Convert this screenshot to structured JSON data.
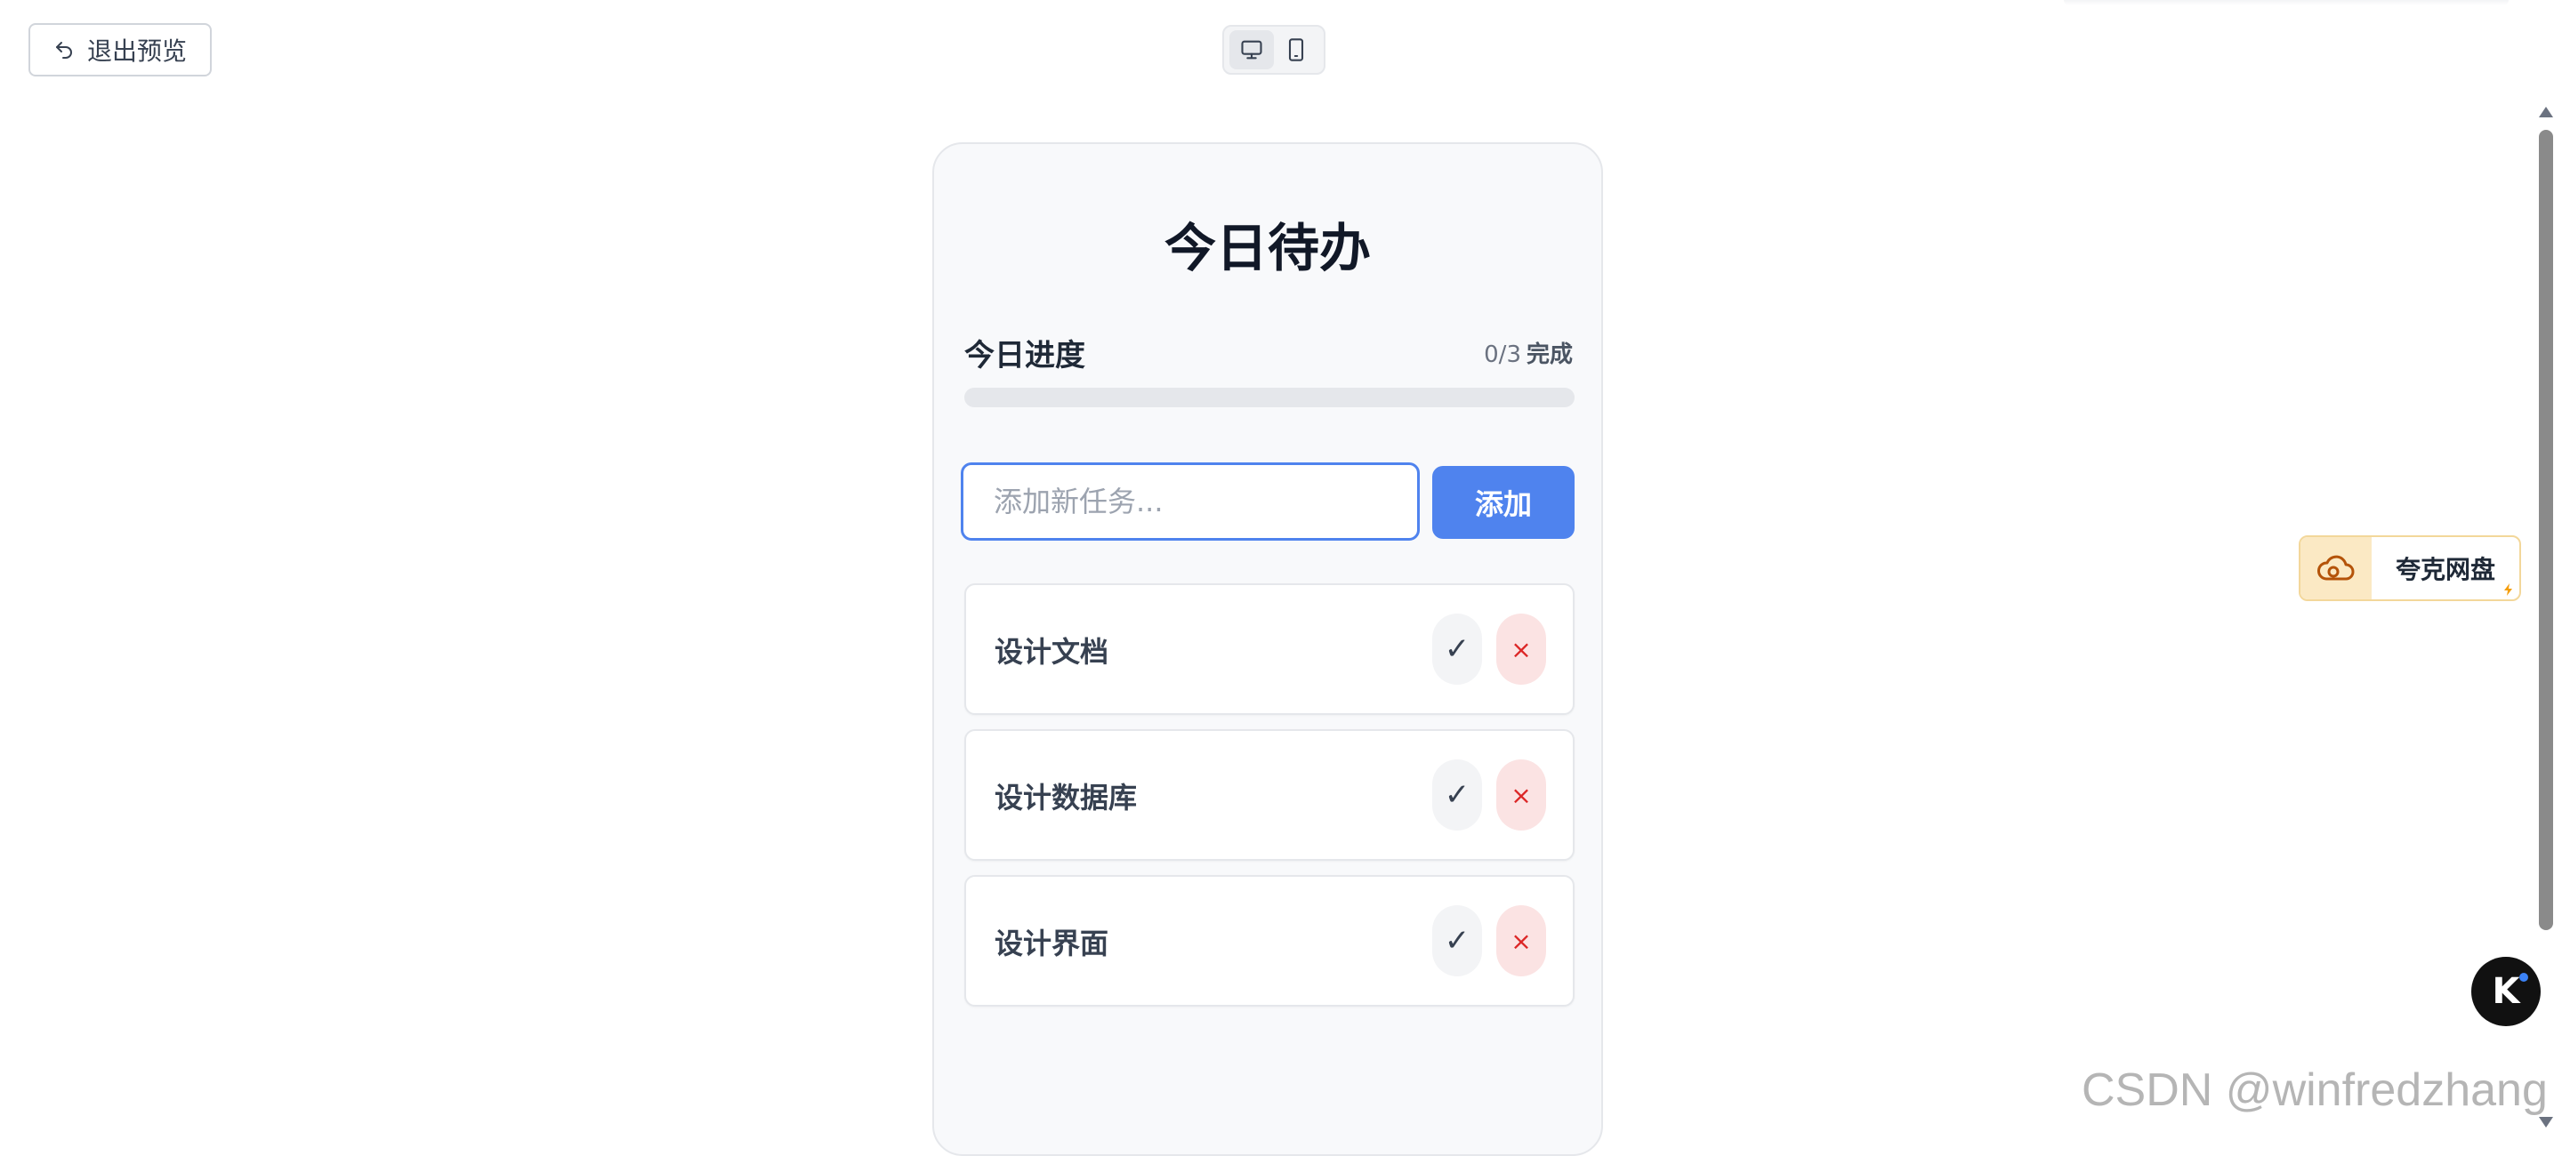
{
  "toolbar": {
    "exit_label": "退出预览",
    "device_modes": [
      "desktop",
      "mobile"
    ],
    "active_device": "desktop"
  },
  "app": {
    "title": "今日待办",
    "progress_label": "今日进度",
    "progress_count": "0/3",
    "progress_done_word": "完成",
    "progress_fraction": 0,
    "input_placeholder": "添加新任务...",
    "input_value": "",
    "add_label": "添加",
    "tasks": [
      {
        "text": "设计文档",
        "done_symbol": "✓",
        "delete_symbol": "×"
      },
      {
        "text": "设计数据库",
        "done_symbol": "✓",
        "delete_symbol": "×"
      },
      {
        "text": "设计界面",
        "done_symbol": "✓",
        "delete_symbol": "×"
      }
    ]
  },
  "widgets": {
    "quark_label": "夸克网盘",
    "k_label": "K"
  },
  "watermark": "CSDN @winfredzhang",
  "colors": {
    "accent": "#4f83ee",
    "delete_bg": "#fbe3e3",
    "delete_fg": "#dc2626",
    "quark_bg": "#fbe9c4"
  },
  "icons": {
    "exit": "undo-arrow-icon",
    "desktop": "monitor-icon",
    "mobile": "phone-icon",
    "quark": "cloud-icon"
  }
}
